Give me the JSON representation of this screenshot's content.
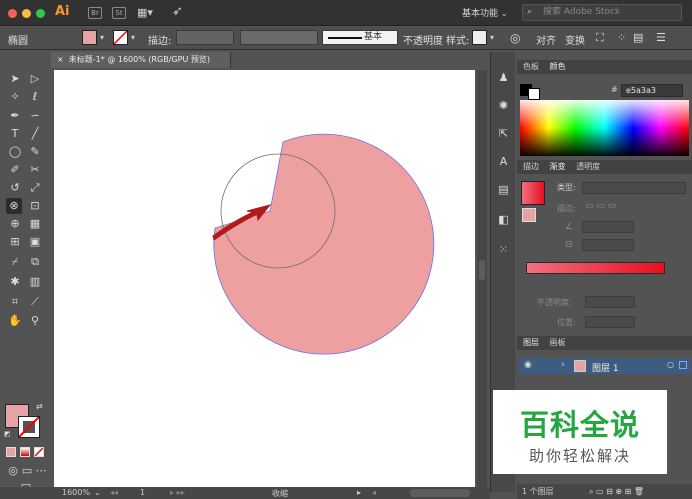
{
  "app": {
    "logo": "Ai",
    "workspace": "基本功能",
    "search_placeholder": "搜索 Adobe Stock",
    "br_icon": "Br",
    "st_icon": "St"
  },
  "colors": {
    "fill": "#e5a3a3",
    "stroke_path": "#6f6fd8",
    "arrow": "#b01a1a",
    "watermark_green": "#25a640",
    "gradient_start": "#f07080",
    "gradient_end": "#e81020"
  },
  "controlbar": {
    "object_type": "椭圆",
    "stroke_label": "描边:",
    "stroke_style": "基本",
    "opacity_label": "不透明度",
    "style_label": "样式:",
    "align_label": "对齐",
    "transform_label": "变换"
  },
  "document": {
    "tab_title": "未标题-1* @ 1600% (RGB/GPU 预览)",
    "close": "×"
  },
  "statusbar": {
    "zoom": "1600%",
    "page": "1",
    "mode": "收缩"
  },
  "color_panel": {
    "tabs": [
      "色板",
      "颜色"
    ],
    "active": "颜色",
    "hex": "e5a3a3",
    "hash": "#"
  },
  "gradient_panel": {
    "tabs": [
      "描边",
      "渐变",
      "透明度"
    ],
    "active": "渐变",
    "type_label": "类型:",
    "stroke_label": "描边:",
    "opacity_label": "不透明度:",
    "position_label": "位置:"
  },
  "layers_panel": {
    "tabs": [
      "图层",
      "画板"
    ],
    "active": "图层",
    "layer_name": "图层 1",
    "footer": "1 个图层"
  },
  "watermark": {
    "title": "百科全说",
    "subtitle": "助你轻松解决"
  }
}
